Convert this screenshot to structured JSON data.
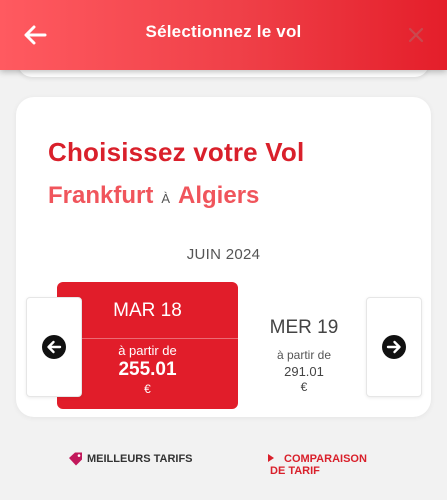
{
  "header": {
    "title": "Sélectionnez le vol",
    "back_icon": "arrow-left-icon",
    "close_icon": "close-icon"
  },
  "main": {
    "title": "Choisissez votre Vol",
    "origin": "Frankfurt",
    "separator": "À",
    "destination": "Algiers",
    "month": "JUIN 2024"
  },
  "dates": {
    "selected": {
      "day": "MAR 18",
      "from_label": "à partir de",
      "price": "255.01",
      "currency": "€"
    },
    "next": {
      "day": "MER 19",
      "from_label": "à partir de",
      "price": "291.01",
      "currency": "€"
    }
  },
  "footer": {
    "best_label": "MEILLEURS TARIFS",
    "compare_label_line1": "COMPARAISON",
    "compare_label_line2": "DE TARIF"
  },
  "colors": {
    "accent": "#e11d2a",
    "header_start": "#ff5a60",
    "header_end": "#e41e2a",
    "route": "#f0555c"
  }
}
